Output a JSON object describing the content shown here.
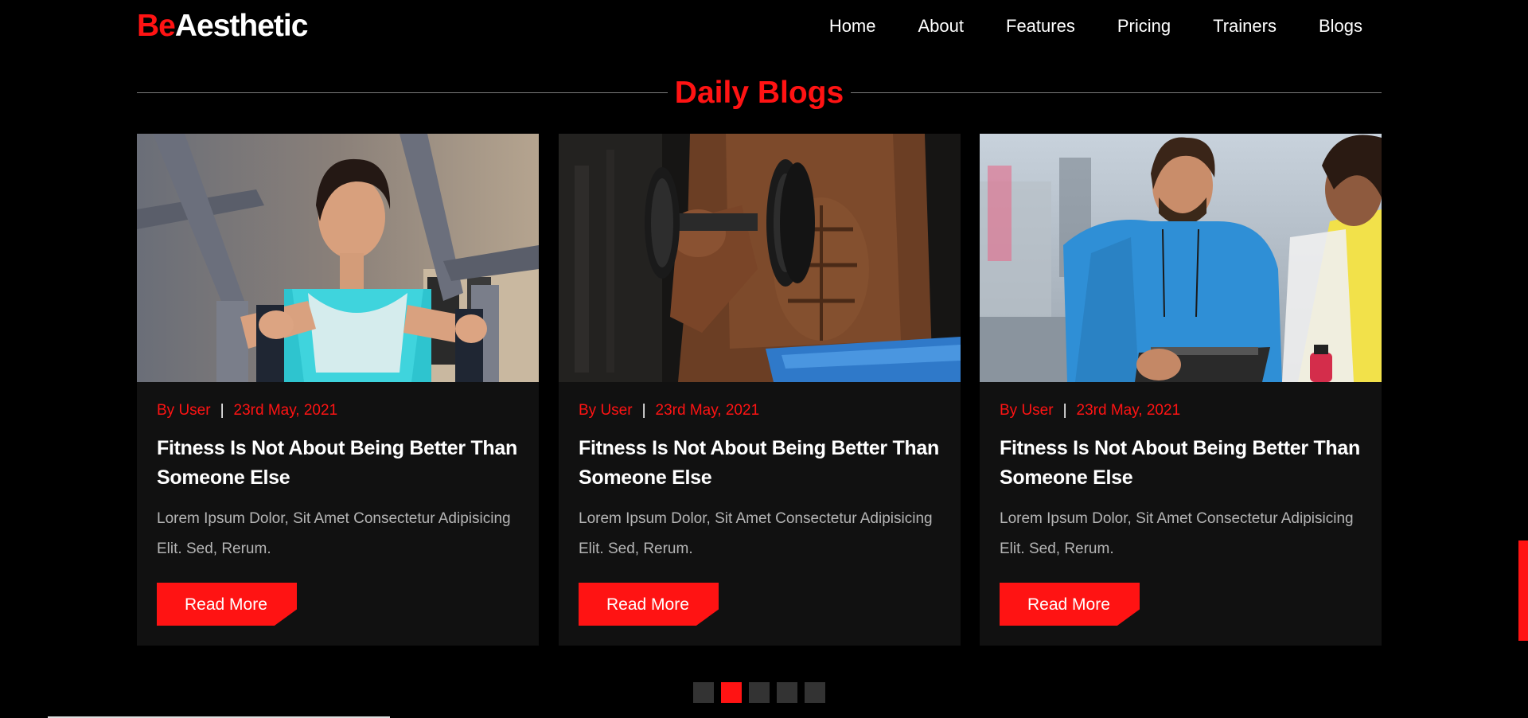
{
  "brand": {
    "accent": "Be",
    "rest": "Aesthetic",
    "accent_color": "#ff1313"
  },
  "nav": {
    "items": [
      {
        "label": "Home"
      },
      {
        "label": "About"
      },
      {
        "label": "Features"
      },
      {
        "label": "Pricing"
      },
      {
        "label": "Trainers"
      },
      {
        "label": "Blogs"
      }
    ]
  },
  "section": {
    "title": "Daily Blogs"
  },
  "cards": [
    {
      "image": "woman-chest-press-photo",
      "author": "By User",
      "separator": "|",
      "date": "23rd May, 2021",
      "title": "Fitness Is Not About Being Better Than Someone Else",
      "text": "Lorem Ipsum Dolor, Sit Amet Consectetur Adipisicing Elit. Sed, Rerum.",
      "button": "Read More"
    },
    {
      "image": "man-dumbbell-curl-photo",
      "author": "By User",
      "separator": "|",
      "date": "23rd May, 2021",
      "title": "Fitness Is Not About Being Better Than Someone Else",
      "text": "Lorem Ipsum Dolor, Sit Amet Consectetur Adipisicing Elit. Sed, Rerum.",
      "button": "Read More"
    },
    {
      "image": "trainer-clipboard-photo",
      "author": "By User",
      "separator": "|",
      "date": "23rd May, 2021",
      "title": "Fitness Is Not About Being Better Than Someone Else",
      "text": "Lorem Ipsum Dolor, Sit Amet Consectetur Adipisicing Elit. Sed, Rerum.",
      "button": "Read More"
    }
  ],
  "pagination": {
    "count": 5,
    "active_index": 1,
    "active_color": "#ff1313",
    "inactive_color": "#333333"
  }
}
